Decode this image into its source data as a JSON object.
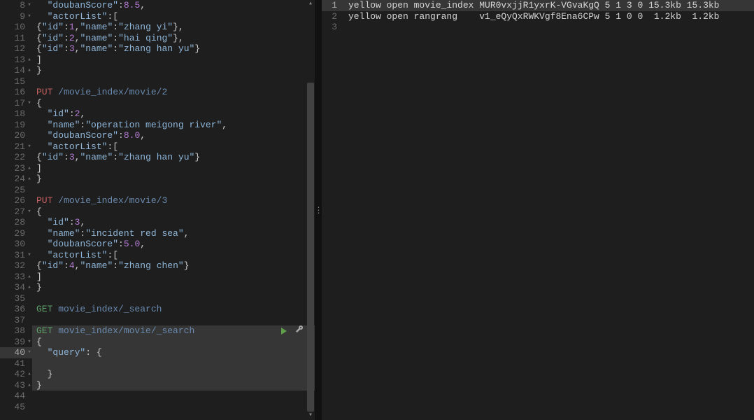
{
  "left": {
    "lines": [
      {
        "n": 8,
        "fold": "v",
        "tokens": [
          [
            "plain",
            "  "
          ],
          [
            "key",
            "\"doubanScore\""
          ],
          [
            "pun",
            ":"
          ],
          [
            "num",
            "8.5"
          ],
          [
            "pun",
            ","
          ]
        ]
      },
      {
        "n": 9,
        "fold": "v",
        "tokens": [
          [
            "plain",
            "  "
          ],
          [
            "key",
            "\"actorList\""
          ],
          [
            "pun",
            ":["
          ]
        ]
      },
      {
        "n": 10,
        "tokens": [
          [
            "brc",
            "{"
          ],
          [
            "key",
            "\"id\""
          ],
          [
            "pun",
            ":"
          ],
          [
            "num",
            "1"
          ],
          [
            "pun",
            ","
          ],
          [
            "key",
            "\"name\""
          ],
          [
            "pun",
            ":"
          ],
          [
            "str",
            "\"zhang yi\""
          ],
          [
            "brc",
            "}"
          ],
          [
            "pun",
            ","
          ]
        ]
      },
      {
        "n": 11,
        "tokens": [
          [
            "brc",
            "{"
          ],
          [
            "key",
            "\"id\""
          ],
          [
            "pun",
            ":"
          ],
          [
            "num",
            "2"
          ],
          [
            "pun",
            ","
          ],
          [
            "key",
            "\"name\""
          ],
          [
            "pun",
            ":"
          ],
          [
            "str",
            "\"hai qing\""
          ],
          [
            "brc",
            "}"
          ],
          [
            "pun",
            ","
          ]
        ]
      },
      {
        "n": 12,
        "tokens": [
          [
            "brc",
            "{"
          ],
          [
            "key",
            "\"id\""
          ],
          [
            "pun",
            ":"
          ],
          [
            "num",
            "3"
          ],
          [
            "pun",
            ","
          ],
          [
            "key",
            "\"name\""
          ],
          [
            "pun",
            ":"
          ],
          [
            "str",
            "\"zhang han yu\""
          ],
          [
            "brc",
            "}"
          ]
        ]
      },
      {
        "n": 13,
        "fold": "^",
        "tokens": [
          [
            "brc",
            "]"
          ]
        ]
      },
      {
        "n": 14,
        "fold": "^",
        "tokens": [
          [
            "brc",
            "}"
          ]
        ]
      },
      {
        "n": 15,
        "tokens": []
      },
      {
        "n": 16,
        "tokens": [
          [
            "kw",
            "PUT"
          ],
          [
            "plain",
            " "
          ],
          [
            "path",
            "/movie_index/movie/2"
          ]
        ]
      },
      {
        "n": 17,
        "fold": "v",
        "tokens": [
          [
            "brc",
            "{"
          ]
        ]
      },
      {
        "n": 18,
        "tokens": [
          [
            "plain",
            "  "
          ],
          [
            "key",
            "\"id\""
          ],
          [
            "pun",
            ":"
          ],
          [
            "num",
            "2"
          ],
          [
            "pun",
            ","
          ]
        ]
      },
      {
        "n": 19,
        "tokens": [
          [
            "plain",
            "  "
          ],
          [
            "key",
            "\"name\""
          ],
          [
            "pun",
            ":"
          ],
          [
            "str",
            "\"operation meigong river\""
          ],
          [
            "pun",
            ","
          ]
        ]
      },
      {
        "n": 20,
        "tokens": [
          [
            "plain",
            "  "
          ],
          [
            "key",
            "\"doubanScore\""
          ],
          [
            "pun",
            ":"
          ],
          [
            "num",
            "8.0"
          ],
          [
            "pun",
            ","
          ]
        ]
      },
      {
        "n": 21,
        "fold": "v",
        "tokens": [
          [
            "plain",
            "  "
          ],
          [
            "key",
            "\"actorList\""
          ],
          [
            "pun",
            ":["
          ]
        ]
      },
      {
        "n": 22,
        "tokens": [
          [
            "brc",
            "{"
          ],
          [
            "key",
            "\"id\""
          ],
          [
            "pun",
            ":"
          ],
          [
            "num",
            "3"
          ],
          [
            "pun",
            ","
          ],
          [
            "key",
            "\"name\""
          ],
          [
            "pun",
            ":"
          ],
          [
            "str",
            "\"zhang han yu\""
          ],
          [
            "brc",
            "}"
          ]
        ]
      },
      {
        "n": 23,
        "fold": "^",
        "tokens": [
          [
            "brc",
            "]"
          ]
        ]
      },
      {
        "n": 24,
        "fold": "^",
        "tokens": [
          [
            "brc",
            "}"
          ]
        ]
      },
      {
        "n": 25,
        "tokens": []
      },
      {
        "n": 26,
        "tokens": [
          [
            "kw",
            "PUT"
          ],
          [
            "plain",
            " "
          ],
          [
            "path",
            "/movie_index/movie/3"
          ]
        ]
      },
      {
        "n": 27,
        "fold": "v",
        "tokens": [
          [
            "brc",
            "{"
          ]
        ]
      },
      {
        "n": 28,
        "tokens": [
          [
            "plain",
            "  "
          ],
          [
            "key",
            "\"id\""
          ],
          [
            "pun",
            ":"
          ],
          [
            "num",
            "3"
          ],
          [
            "pun",
            ","
          ]
        ]
      },
      {
        "n": 29,
        "tokens": [
          [
            "plain",
            "  "
          ],
          [
            "key",
            "\"name\""
          ],
          [
            "pun",
            ":"
          ],
          [
            "str",
            "\"incident red sea\""
          ],
          [
            "pun",
            ","
          ]
        ]
      },
      {
        "n": 30,
        "tokens": [
          [
            "plain",
            "  "
          ],
          [
            "key",
            "\"doubanScore\""
          ],
          [
            "pun",
            ":"
          ],
          [
            "num",
            "5.0"
          ],
          [
            "pun",
            ","
          ]
        ]
      },
      {
        "n": 31,
        "fold": "v",
        "tokens": [
          [
            "plain",
            "  "
          ],
          [
            "key",
            "\"actorList\""
          ],
          [
            "pun",
            ":["
          ]
        ]
      },
      {
        "n": 32,
        "tokens": [
          [
            "brc",
            "{"
          ],
          [
            "key",
            "\"id\""
          ],
          [
            "pun",
            ":"
          ],
          [
            "num",
            "4"
          ],
          [
            "pun",
            ","
          ],
          [
            "key",
            "\"name\""
          ],
          [
            "pun",
            ":"
          ],
          [
            "str",
            "\"zhang chen\""
          ],
          [
            "brc",
            "}"
          ]
        ]
      },
      {
        "n": 33,
        "fold": "^",
        "tokens": [
          [
            "brc",
            "]"
          ]
        ]
      },
      {
        "n": 34,
        "fold": "^",
        "tokens": [
          [
            "brc",
            "}"
          ]
        ]
      },
      {
        "n": 35,
        "tokens": []
      },
      {
        "n": 36,
        "tokens": [
          [
            "kw2",
            "GET"
          ],
          [
            "plain",
            " "
          ],
          [
            "path",
            "movie_index/_search"
          ]
        ]
      },
      {
        "n": 37,
        "tokens": []
      },
      {
        "n": 38,
        "hl": true,
        "actions": true,
        "tokens": [
          [
            "kw2",
            "GET"
          ],
          [
            "plain",
            " "
          ],
          [
            "path",
            "movie_index/movie/_search"
          ]
        ]
      },
      {
        "n": 39,
        "fold": "v",
        "hl": true,
        "tokens": [
          [
            "brc",
            "{"
          ]
        ]
      },
      {
        "n": 40,
        "fold": "v",
        "hl": true,
        "cursor": true,
        "tokens": [
          [
            "plain",
            "  "
          ],
          [
            "key",
            "\"query\""
          ],
          [
            "pun",
            ": "
          ],
          [
            "brc",
            "{"
          ]
        ]
      },
      {
        "n": 41,
        "hl": true,
        "tokens": [
          [
            "plain",
            "    "
          ]
        ]
      },
      {
        "n": 42,
        "fold": "^",
        "hl": true,
        "tokens": [
          [
            "plain",
            "  "
          ],
          [
            "brc",
            "}"
          ]
        ]
      },
      {
        "n": 43,
        "fold": "^",
        "hl": true,
        "tokens": [
          [
            "brc",
            "}"
          ]
        ]
      },
      {
        "n": 44,
        "tokens": []
      },
      {
        "n": 45,
        "tokens": []
      }
    ],
    "scroll": {
      "thumbTop": 118,
      "thumbHeight": 470
    }
  },
  "right": {
    "lines": [
      {
        "n": 1,
        "hl": true,
        "text": "yellow open movie_index MUR0vxjjR1yxrK-VGvaKgQ 5 1 3 0 15.3kb 15.3kb"
      },
      {
        "n": 2,
        "text": "yellow open rangrang    v1_eQyQxRWKVgf8Ena6CPw 5 1 0 0  1.2kb  1.2kb"
      },
      {
        "n": 3,
        "text": ""
      }
    ]
  },
  "icons": {
    "play": "play-icon",
    "wrench": "wrench-icon"
  }
}
